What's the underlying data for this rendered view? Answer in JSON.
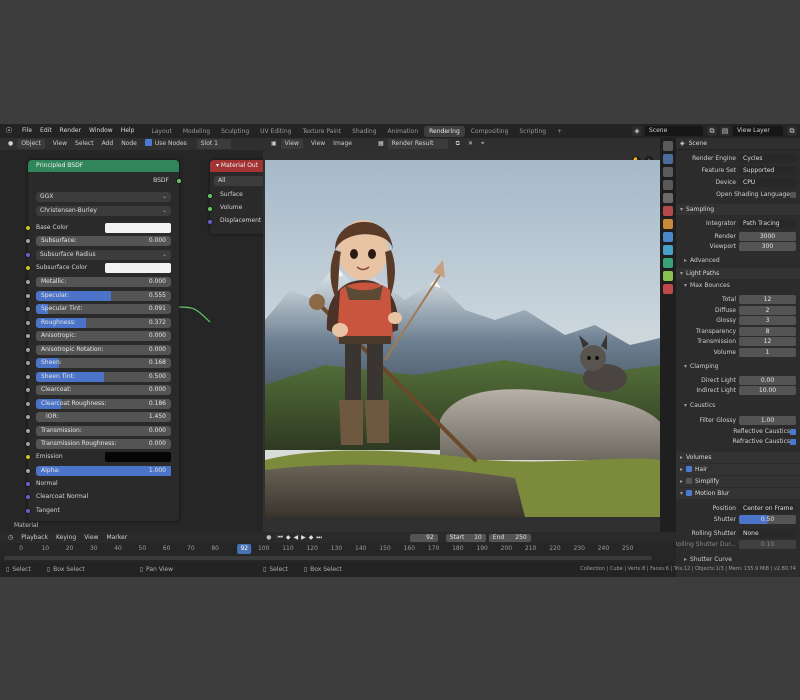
{
  "topbar": {
    "menus": [
      "File",
      "Edit",
      "Render",
      "Window",
      "Help"
    ],
    "workspaces": [
      "Layout",
      "Modeling",
      "Sculpting",
      "UV Editing",
      "Texture Paint",
      "Shading",
      "Animation",
      "Rendering",
      "Compositing",
      "Scripting"
    ],
    "active_workspace": "Rendering",
    "scene": "Scene",
    "view_layer": "View Layer"
  },
  "node_editor": {
    "header": {
      "mode": "Object",
      "view": "View",
      "select": "Select",
      "add": "Add",
      "node": "Node",
      "use_nodes": "Use Nodes",
      "slot": "Slot 1"
    },
    "bsdf": {
      "title": "Principled BSDF",
      "output": "BSDF",
      "distribution": "GGX",
      "subsurface_method": "Christensen-Burley",
      "base_color": "Base Color",
      "subsurface": {
        "label": "Subsurface:",
        "value": "0.000"
      },
      "subsurface_radius": "Subsurface Radius",
      "subsurface_color": "Subsurface Color",
      "params": [
        {
          "label": "Metallic:",
          "value": "0.000",
          "fill": 0.0
        },
        {
          "label": "Specular:",
          "value": "0.555",
          "fill": 0.555
        },
        {
          "label": "Specular Tint:",
          "value": "0.091",
          "fill": 0.091
        },
        {
          "label": "Roughness:",
          "value": "0.372",
          "fill": 0.372
        },
        {
          "label": "Anisotropic:",
          "value": "0.000",
          "fill": 0.0
        },
        {
          "label": "Anisotropic Rotation:",
          "value": "0.000",
          "fill": 0.0
        },
        {
          "label": "Sheen:",
          "value": "0.168",
          "fill": 0.168
        },
        {
          "label": "Sheen Tint:",
          "value": "0.500",
          "fill": 0.5
        },
        {
          "label": "Clearcoat:",
          "value": "0.000",
          "fill": 0.0
        },
        {
          "label": "Clearcoat Roughness:",
          "value": "0.186",
          "fill": 0.186
        },
        {
          "label": "IOR:",
          "value": "1.450",
          "fill": 0.0
        },
        {
          "label": "Transmission:",
          "value": "0.000",
          "fill": 0.0
        },
        {
          "label": "Transmission Roughness:",
          "value": "0.000",
          "fill": 0.0
        }
      ],
      "emission": "Emission",
      "alpha": {
        "label": "Alpha:",
        "value": "1.000",
        "fill": 1.0
      },
      "normal": "Normal",
      "clearcoat_normal": "Clearcoat Normal",
      "tangent": "Tangent"
    },
    "material_output": {
      "title": "Material Out",
      "target": "All",
      "sockets": [
        "Surface",
        "Volume",
        "Displacement"
      ]
    },
    "corner_label": "Material"
  },
  "image_editor": {
    "header": {
      "view": "View",
      "view2": "View",
      "image": "Image",
      "image_name": "Render Result"
    }
  },
  "properties": {
    "header": "Scene",
    "render_engine": {
      "label": "Render Engine",
      "value": "Cycles"
    },
    "feature_set": {
      "label": "Feature Set",
      "value": "Supported"
    },
    "device": {
      "label": "Device",
      "value": "CPU"
    },
    "osl": "Open Shading Language",
    "sampling": "Sampling",
    "integrator": {
      "label": "Integrator",
      "value": "Path Tracing"
    },
    "render_samples": {
      "label": "Render",
      "value": "3000"
    },
    "viewport_samples": {
      "label": "Viewport",
      "value": "300"
    },
    "advanced": "Advanced",
    "light_paths": "Light Paths",
    "max_bounces": "Max Bounces",
    "bounces": [
      {
        "label": "Total",
        "value": "12"
      },
      {
        "label": "Diffuse",
        "value": "2"
      },
      {
        "label": "Glossy",
        "value": "3"
      },
      {
        "label": "Transparency",
        "value": "8"
      },
      {
        "label": "Transmission",
        "value": "12"
      },
      {
        "label": "Volume",
        "value": "1"
      }
    ],
    "clamping": "Clamping",
    "direct_light": {
      "label": "Direct Light",
      "value": "0.00"
    },
    "indirect_light": {
      "label": "Indirect Light",
      "value": "10.00"
    },
    "caustics": "Caustics",
    "filter_glossy": {
      "label": "Filter Glossy",
      "value": "1.00"
    },
    "reflective_caustics": "Reflective Caustics",
    "refractive_caustics": "Refractive Caustics",
    "volumes": "Volumes",
    "hair": "Hair",
    "simplify": "Simplify",
    "motion_blur": "Motion Blur",
    "position": {
      "label": "Position",
      "value": "Center on Frame"
    },
    "shutter": {
      "label": "Shutter",
      "value": "0.50"
    },
    "rolling_shutter": {
      "label": "Rolling Shutter",
      "value": "None"
    },
    "rolling_duration": {
      "label": "Rolling Shutter Dur...",
      "value": "0.10"
    },
    "shutter_curve": "Shutter Curve"
  },
  "timeline": {
    "playback": "Playback",
    "keying": "Keying",
    "view": "View",
    "marker": "Marker",
    "current_frame": "92",
    "start_label": "Start",
    "start": "10",
    "end_label": "End",
    "end": "250",
    "ticks": [
      "0",
      "10",
      "20",
      "30",
      "40",
      "50",
      "60",
      "70",
      "80",
      "92",
      "100",
      "110",
      "120",
      "130",
      "140",
      "150",
      "160",
      "170",
      "180",
      "190",
      "200",
      "210",
      "220",
      "230",
      "240",
      "250"
    ]
  },
  "statusbar": {
    "select": "Select",
    "box_select": "Box Select",
    "pan_view": "Pan View",
    "select2": "Select",
    "box_select2": "Box Select",
    "stats": "Collection | Cube | Verts:8 | Faces:6 | Tris:12 | Objects:1/3 | Mem: 155.9 MiB | v2.80.74"
  },
  "colors": {
    "bsdf_header": "#31855b",
    "output_header": "#a33434",
    "accent_blue": "#4b74c8"
  }
}
